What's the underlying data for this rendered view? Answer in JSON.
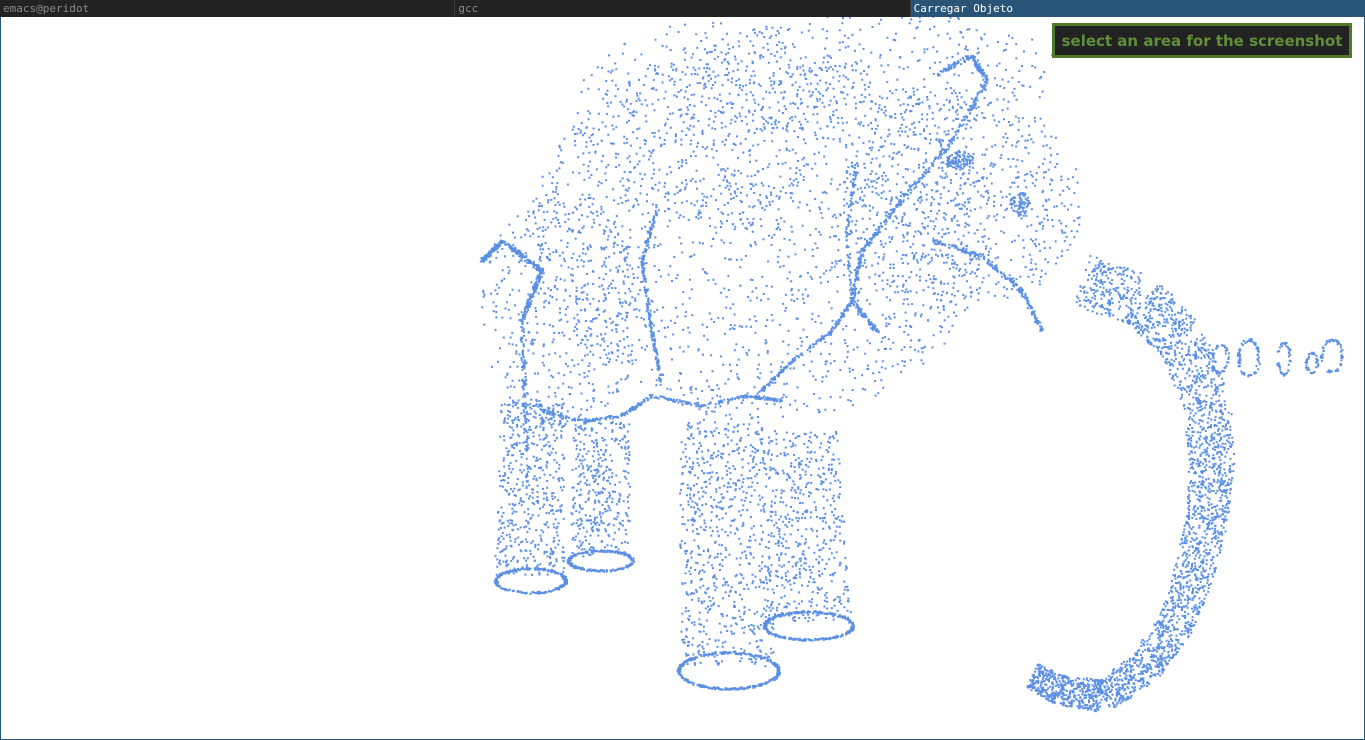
{
  "taskbar": {
    "tabs": [
      {
        "label": "emacs@peridot"
      },
      {
        "label": "gcc"
      },
      {
        "label": "Carregar Objeto"
      }
    ]
  },
  "screenshot_tool": {
    "prompt": "select an area for the screenshot"
  },
  "viewer": {
    "model": "elephant-point-cloud",
    "point_color": "#5b8fe3",
    "background": "#ffffff"
  }
}
